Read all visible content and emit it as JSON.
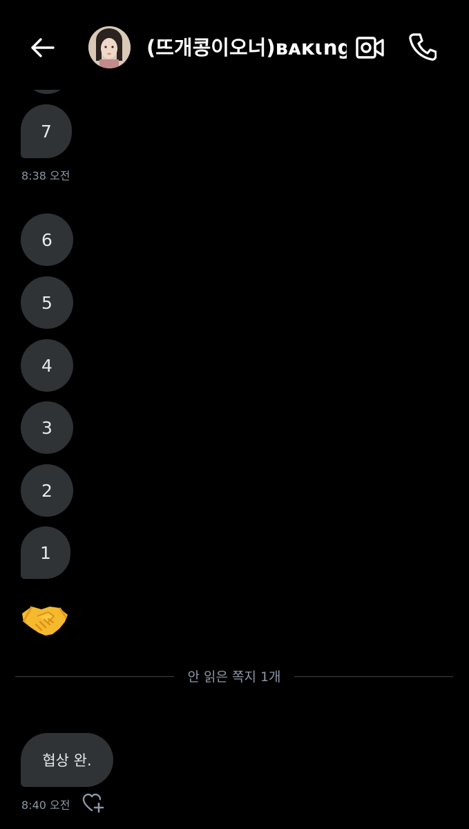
{
  "header": {
    "title": "(뜨개콩이오너)ʙᴀᴋɩng ...",
    "back_icon": "arrow-left-icon",
    "video_icon": "video-camera-icon",
    "call_icon": "phone-icon"
  },
  "messages": {
    "seven": "7",
    "ts_1": "8:38 오전",
    "six": "6",
    "five": "5",
    "four": "4",
    "three": "3",
    "two": "2",
    "one": "1",
    "emoji": "handshake-emoji",
    "unread_divider": "안 읽은 쪽지 1개",
    "last_text": "협상 완.",
    "ts_2": "8:40 오전"
  },
  "colors": {
    "background": "#000000",
    "bubble": "#2f3336",
    "text": "#e7e9ea",
    "muted": "#8b98a5"
  }
}
